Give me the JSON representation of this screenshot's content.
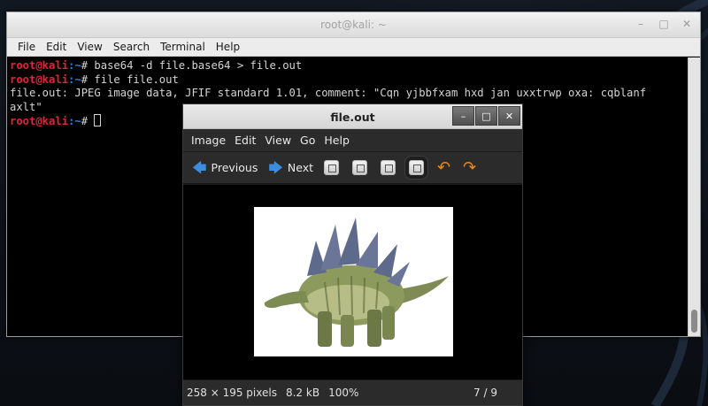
{
  "terminal": {
    "title": "root@kali: ~",
    "menu": [
      "File",
      "Edit",
      "View",
      "Search",
      "Terminal",
      "Help"
    ],
    "lines": [
      {
        "user": "root@kali",
        "path": ":~",
        "cmd": "# base64 -d file.base64 > file.out"
      },
      {
        "user": "root@kali",
        "path": ":~",
        "cmd": "# file file.out"
      },
      {
        "output": "file.out: JPEG image data, JFIF standard 1.01, comment: \"Cqn yjbbfxam hxd jan uxxtrwp oxa: cqblanf"
      },
      {
        "output": "axlt\""
      },
      {
        "user": "root@kali",
        "path": ":~",
        "cmd": "# "
      }
    ],
    "controls": {
      "minimize": "–",
      "maximize": "□",
      "close": "✕"
    }
  },
  "viewer": {
    "title": "file.out",
    "menu": [
      "Image",
      "Edit",
      "View",
      "Go",
      "Help"
    ],
    "toolbar": {
      "previous_label": "Previous",
      "next_label": "Next",
      "icons": [
        "zoom-in-icon",
        "zoom-out-icon",
        "normal-size-icon",
        "best-fit-icon"
      ],
      "rotate_left_icon": "rotate-left-icon",
      "rotate_right_icon": "rotate-right-icon"
    },
    "controls": {
      "minimize": "–",
      "maximize": "□",
      "close": "✕"
    },
    "status": {
      "dimensions": "258 × 195 pixels",
      "size": "8.2 kB",
      "zoom": "100%",
      "position": "7 / 9"
    },
    "image_subject": "stegosaurus"
  },
  "colors": {
    "prompt_user": "#e0243a",
    "prompt_path": "#2f7fd8",
    "nav_arrow": "#3b8de0",
    "rotate_arrow": "#ea8a1e"
  }
}
